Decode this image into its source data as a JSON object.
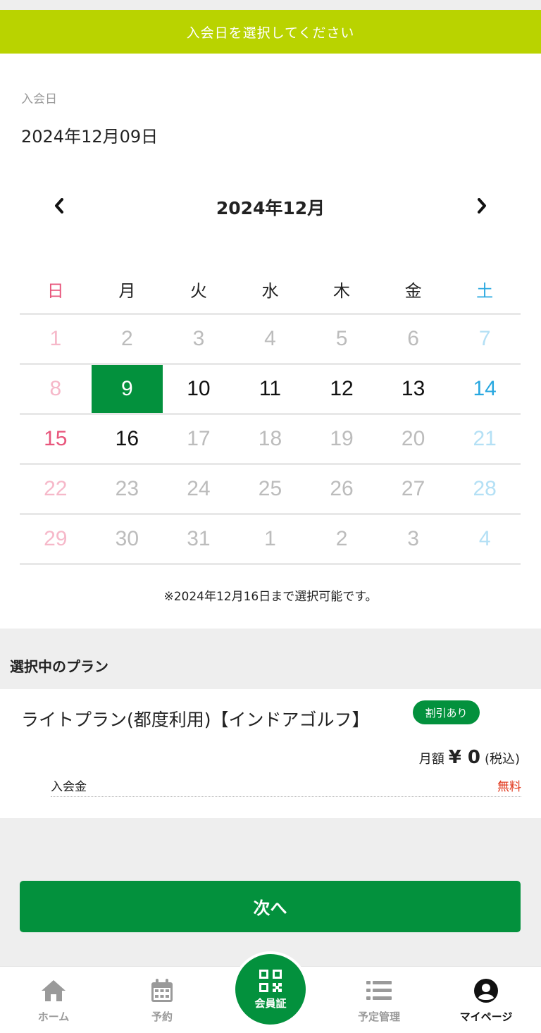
{
  "banner": {
    "title": "入会日を選択してください"
  },
  "join": {
    "label": "入会日",
    "value": "2024年12月09日"
  },
  "calendar": {
    "month_label": "2024年12月",
    "prev_icon": "chevron-left-icon",
    "next_icon": "chevron-right-icon",
    "weekdays": [
      "日",
      "月",
      "火",
      "水",
      "木",
      "金",
      "土"
    ],
    "weeks": [
      [
        "1",
        "2",
        "3",
        "4",
        "5",
        "6",
        "7"
      ],
      [
        "8",
        "9",
        "10",
        "11",
        "12",
        "13",
        "14"
      ],
      [
        "15",
        "16",
        "17",
        "18",
        "19",
        "20",
        "21"
      ],
      [
        "22",
        "23",
        "24",
        "25",
        "26",
        "27",
        "28"
      ],
      [
        "29",
        "30",
        "31",
        "1",
        "2",
        "3",
        "4"
      ]
    ],
    "selected_day": "9",
    "note": "※2024年12月16日まで選択可能です。"
  },
  "plan": {
    "heading": "選択中のプラン",
    "name": "ライトプラン(都度利用)【インドアゴルフ】",
    "badge": "割引あり",
    "price_label": "月額",
    "price_value": "¥ 0",
    "price_tax": "(税込)",
    "fee_label": "入会金",
    "fee_value": "無料"
  },
  "actions": {
    "next_label": "次へ"
  },
  "tabbar": {
    "home": "ホーム",
    "reserve": "予約",
    "member": "会員証",
    "schedule": "予定管理",
    "mypage": "マイページ"
  },
  "colors": {
    "banner": "#b9d300",
    "accent": "#03913d",
    "sunday": "#e8567c",
    "saturday": "#29a8e0",
    "free": "#e0361a"
  }
}
